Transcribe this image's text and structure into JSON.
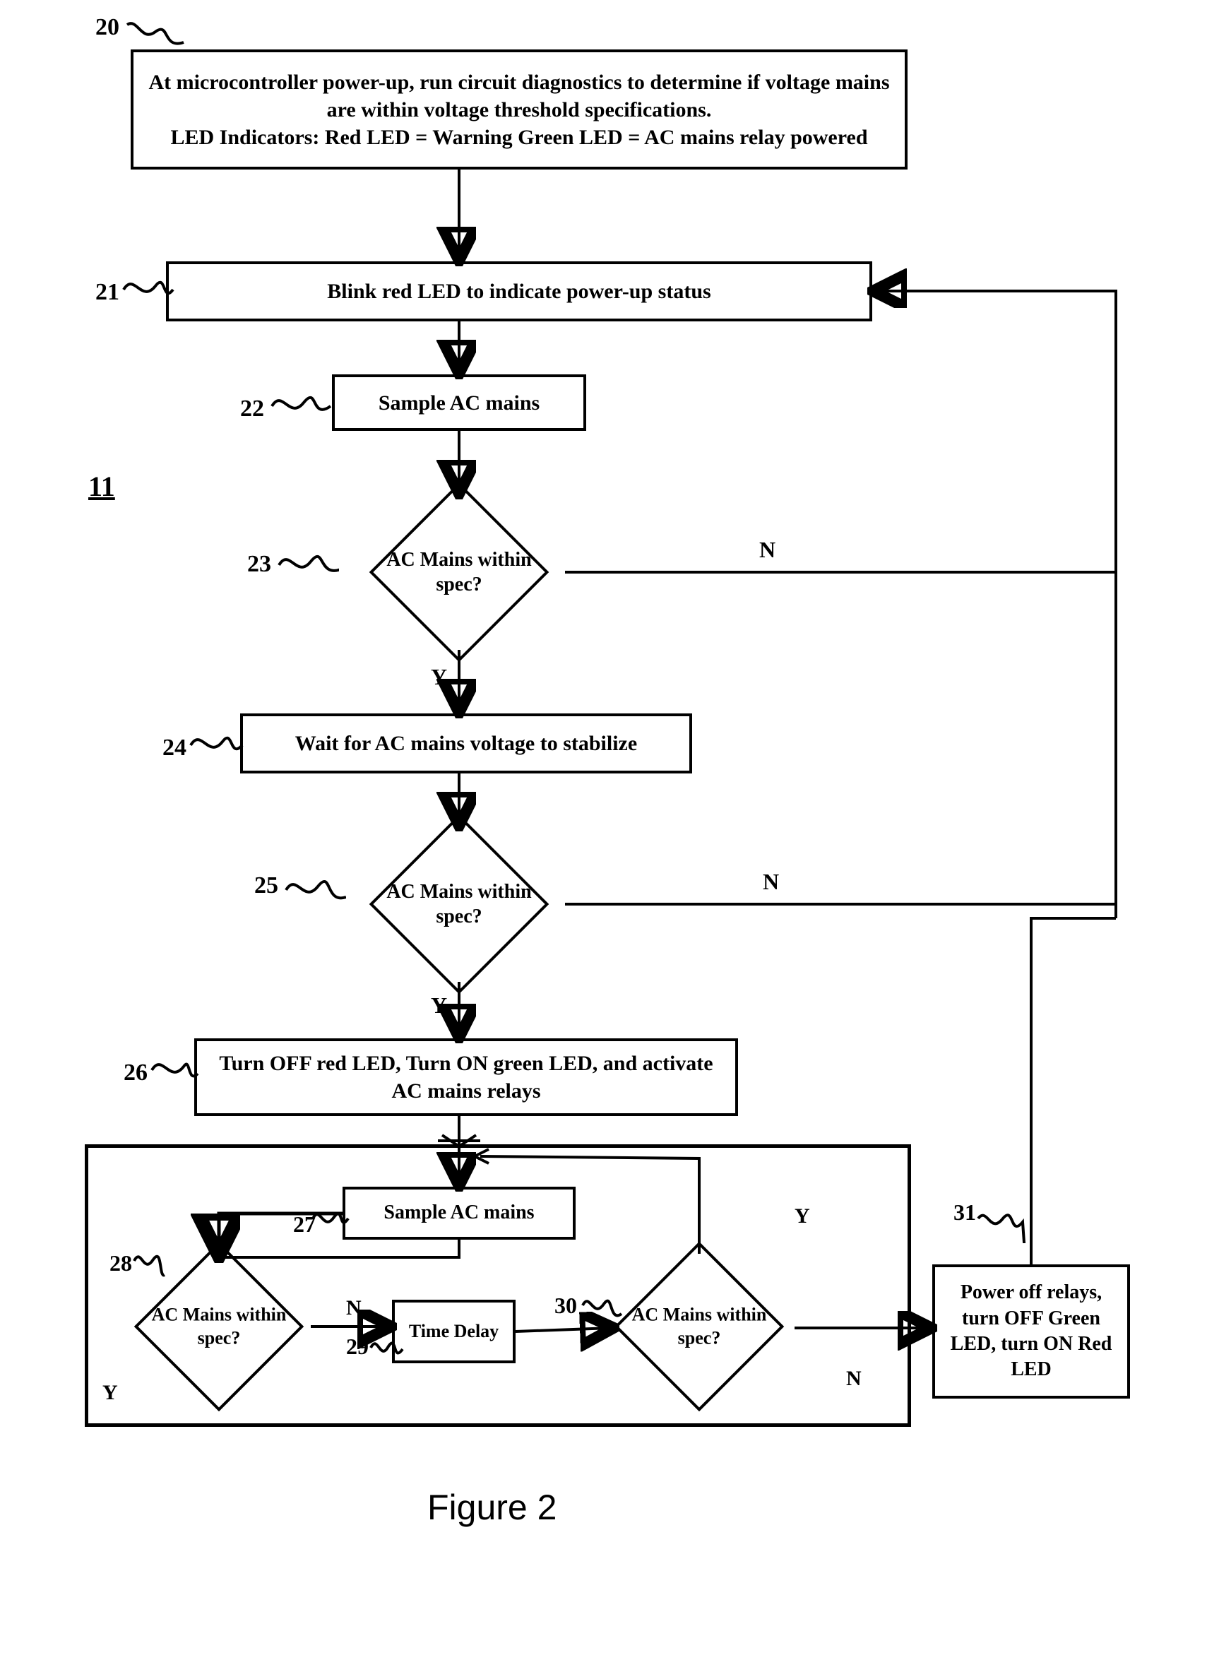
{
  "figure_ref": "11",
  "nodes": {
    "n20": {
      "ref": "20",
      "text": "At microcontroller power-up, run circuit diagnostics to determine if voltage mains are within voltage threshold specifications.\nLED Indicators: Red LED = Warning  Green LED = AC mains relay powered"
    },
    "n21": {
      "ref": "21",
      "text": "Blink red LED to indicate power-up status"
    },
    "n22": {
      "ref": "22",
      "text": "Sample AC mains"
    },
    "n23": {
      "ref": "23",
      "text": "AC Mains within spec?",
      "yes": "Y",
      "no": "N"
    },
    "n24": {
      "ref": "24",
      "text": "Wait for AC mains voltage to stabilize"
    },
    "n25": {
      "ref": "25",
      "text": "AC Mains within spec?",
      "yes": "Y",
      "no": "N"
    },
    "n26": {
      "ref": "26",
      "text": "Turn OFF red LED, Turn ON green LED, and activate AC mains relays"
    },
    "n27": {
      "ref": "27",
      "text": "Sample AC mains"
    },
    "n28": {
      "ref": "28",
      "text": "AC Mains within spec?",
      "yes": "Y",
      "no": "N"
    },
    "n29": {
      "ref": "29",
      "text": "Time Delay"
    },
    "n30": {
      "ref": "30",
      "text": "AC Mains within spec?",
      "yes": "Y",
      "no": "N"
    },
    "n31": {
      "ref": "31",
      "text": "Power off relays, turn OFF Green LED, turn ON Red LED"
    }
  },
  "caption": "Figure 2"
}
